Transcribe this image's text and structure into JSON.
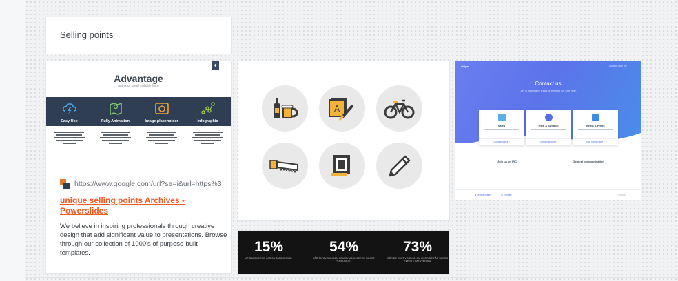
{
  "heading": {
    "label": "Selling points"
  },
  "pin": {
    "advantage": {
      "title": "Advantage",
      "subtitle": "put your great subtitle here",
      "badge": "♦",
      "features": [
        {
          "label": "Easy Use",
          "icon": "lightning-cloud-icon",
          "color": "#4aa8e8"
        },
        {
          "label": "Fully Animation",
          "icon": "map-icon",
          "color": "#7bc86c"
        },
        {
          "label": "Image placeholder",
          "icon": "camera-icon",
          "color": "#f0a531"
        },
        {
          "label": "Infographic",
          "icon": "nodes-icon",
          "color": "#a8d24a"
        }
      ]
    },
    "source_url": "https://www.google.com/url?sa=i&url=https%3",
    "title": "unique selling points Archives - Powerslides",
    "description": "We believe in inspiring professionals through creative design that add significant value to presentations. Browse through our collection of 1000's of purpose-built templates."
  },
  "icons_card": {
    "icons": [
      "beer-icon",
      "drawing-icon",
      "bicycle-icon",
      "saw-icon",
      "frame-icon",
      "pencil-icon"
    ]
  },
  "stats": [
    {
      "value": "15%",
      "caption": "AF DANSKERNE HAR EN TATOVERING"
    },
    {
      "value": "54%",
      "caption": "FÅR TATOVERINGEN SOM SYMBOLISERER NOGET PERSONLIGT"
    },
    {
      "value": "73%",
      "caption": "GÅR DE OVERVEJELSE OM HVOR DE FÅR DERES FØRSTE TATOVERING"
    }
  ],
  "contact": {
    "logo": "stripe",
    "nav": "Support   Sign in ›",
    "title": "Contact us",
    "subtitle": "Get in touch and let us know how we can help.",
    "boxes": [
      {
        "title": "Sales",
        "link": "Contact sales ›",
        "color": "#5bb0e8"
      },
      {
        "title": "Help & Support",
        "link": "Contact support ›",
        "color": "#5470e5"
      },
      {
        "title": "Media & Press",
        "link": "Visit press page ›",
        "color": "#3d8ee0"
      }
    ],
    "mid": [
      {
        "title": "Join us on IRC"
      },
      {
        "title": "General communication"
      }
    ],
    "footer_left": "● United States",
    "footer_mid": "⊕ English",
    "footer_right": "© Stripe"
  }
}
